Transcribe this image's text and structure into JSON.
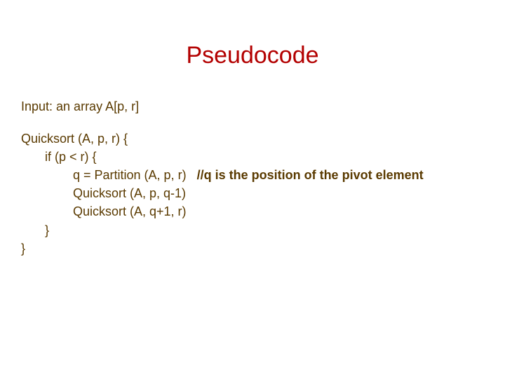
{
  "title": "Pseudocode",
  "lines": {
    "input": "Input: an array A[p, r]",
    "sig": "Quicksort (A, p, r) {",
    "if": "if (p < r) {",
    "assign": "q = Partition (A, p, r)",
    "comment": "//q is the position of the pivot element",
    "rec1": "Quicksort (A, p, q-1)",
    "rec2": "Quicksort (A, q+1, r)",
    "close1": "}",
    "close2": "}"
  }
}
